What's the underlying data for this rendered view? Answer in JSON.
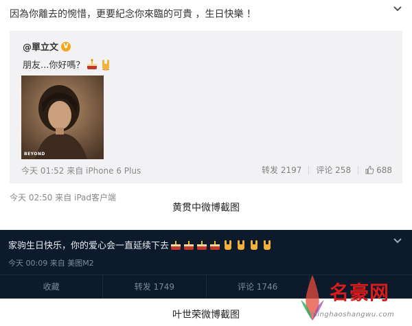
{
  "top_post": {
    "text": "因為你離去的惋惜，更要紀念你來臨的可貴 ，生日快樂 ！",
    "repost": {
      "author": "@單立文",
      "text": "朋友...你好嗎？",
      "photo_brand": "BEYOND",
      "meta": "今天 01:52 来自 iPhone 6 Plus",
      "forward": "转发 2197",
      "comment": "评论 258",
      "like_count": "688"
    },
    "meta": "今天 02:50 来自 iPad客户端"
  },
  "caption_1": "黄贯中微博截图",
  "dark_post": {
    "text": "家驹生日快乐，你的爱心会一直延续下去",
    "meta": "今天 00:09 来自 美图M2",
    "actions": [
      "收藏",
      "转发 1749",
      "评论 1746",
      ""
    ]
  },
  "caption_2": "叶世荣微博截图",
  "watermark": {
    "title": "名豪网",
    "domain": "minghaoshangwu.com"
  },
  "icons": {
    "dropdown": "chevron-down-icon",
    "verified": "verified-v-icon",
    "cake": "cake-emoji-icon",
    "rock_hand": "rock-hand-emoji-icon",
    "like": "thumbs-up-icon"
  },
  "colors": {
    "dark_background": "#0c1a2c",
    "verified_badge": "#f5a623",
    "watermark_red": "#d81b1b"
  }
}
